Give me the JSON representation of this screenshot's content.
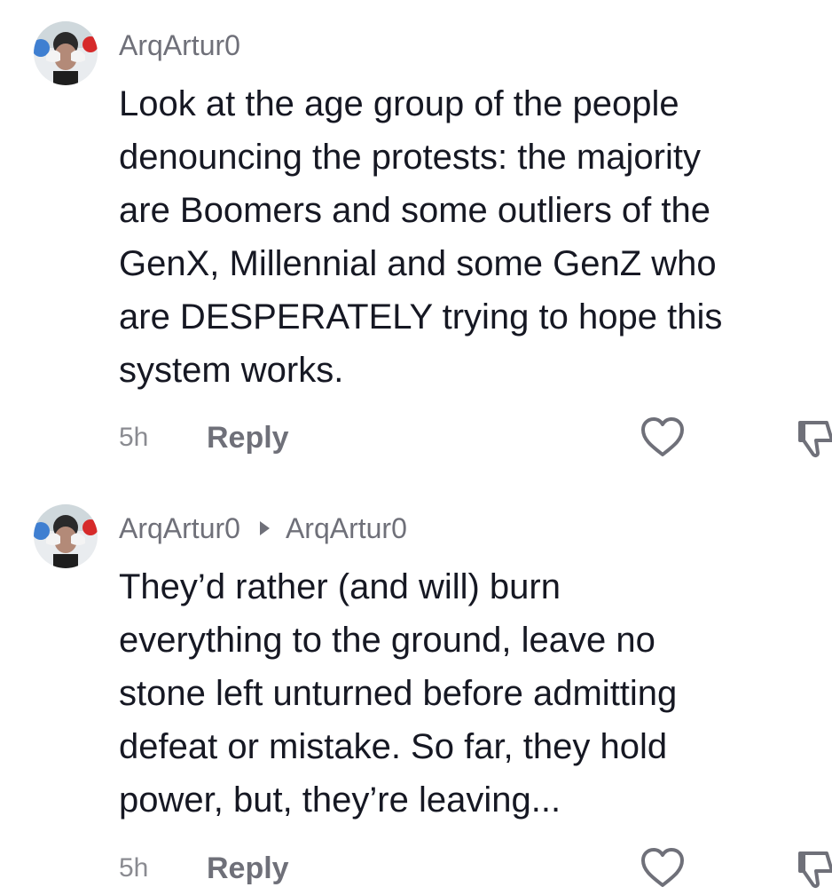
{
  "comments": [
    {
      "author": "ArqArtur0",
      "text": "Look at the age group of the people\ndenouncing the protests: the majority\nare Boomers and some outliers of the\nGenX, Millennial and some GenZ who\nare DESPERATELY trying to hope this\nsystem works.",
      "time": "5h",
      "reply_label": "Reply",
      "like_icon": "heart-outline-icon",
      "dislike_icon": "thumbs-down-icon"
    },
    {
      "author": "ArqArtur0",
      "reply_to": "ArqArtur0",
      "text": "They’d rather (and will) burn\neverything to the ground, leave no\nstone left unturned before admitting\ndefeat or mistake. So far, they hold\npower, but, they’re leaving...",
      "time": "5h",
      "reply_label": "Reply",
      "like_icon": "heart-outline-icon",
      "dislike_icon": "thumbs-down-icon"
    }
  ],
  "colors": {
    "text": "#161823",
    "secondary": "#6f7079",
    "timestamp": "#8a8b91",
    "background": "#ffffff"
  }
}
